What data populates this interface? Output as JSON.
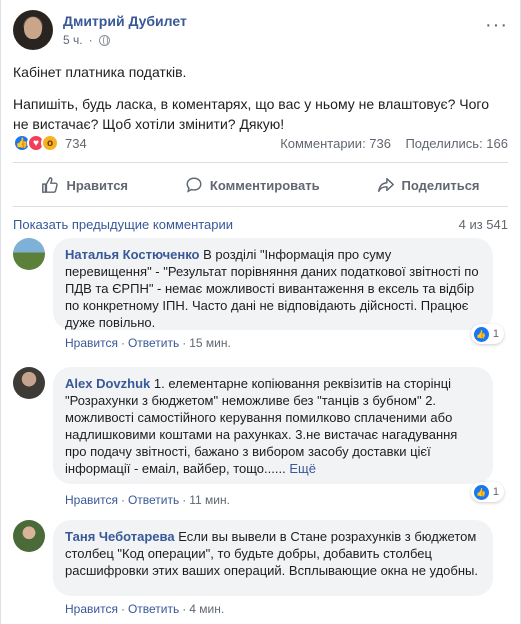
{
  "post": {
    "author": "Дмитрий Дубилет",
    "time": "5 ч.",
    "more": "···",
    "text_1": "Кабінет платника податків.",
    "text_2": "Напишіть, будь ласка, в коментарях, що вас у ньому не влаштовує? Чого не вистачає? Щоб хотіли змінити? Дякую!",
    "reactions_count": "734",
    "comments_count": "Комментарии: 736",
    "shares_count": "Поделились: 166",
    "actions": {
      "like": "Нравится",
      "comment": "Комментировать",
      "share": "Поделиться"
    }
  },
  "comments_header": {
    "show_previous": "Показать предыдущие комментарии",
    "count": "4 из 541"
  },
  "comments": [
    {
      "name": "Наталья Костюченко",
      "text": "В розділі \"Інформація про суму перевищення\" - \"Результат порівняння даних податкової звітності по ПДВ та ЄРПН\" - немає можливості вивантаження в ексель та відбір по конкретному ІПН. Часто дані не відповідають дійсності. Працює дуже повільно.",
      "like": "Нравится",
      "reply": "Ответить",
      "time": "15 мин.",
      "likes": "1"
    },
    {
      "name": "Alex Dovzhuk",
      "text": "1. елементарне копіювання реквізитів на сторінці \"Розрахунки з бюджетом\" неможливе без \"танців з бубном\" 2. можливості самостійного керування помилково сплаченими або надлишковими коштами на рахунках. 3.не вистачає нагадування про подачу звітності, бажано з вибором засобу доставки цієї інформації - емаіл, вайбер, тощо......",
      "more": "Ещё",
      "like": "Нравится",
      "reply": "Ответить",
      "time": "11 мин.",
      "likes": "1"
    },
    {
      "name": "Таня Чеботарева",
      "text": "Если вы вывели в Стане розрахунків з бюджетом столбец \"Код операции\", то будьте добры, добавить столбец расшифровки этих ваших операций. Всплывающие окна не удобны.",
      "like": "Нравится",
      "reply": "Ответить",
      "time": "4 мин."
    }
  ],
  "colors": {
    "link": "#385898",
    "muted": "#606770",
    "bubble": "#f2f3f5",
    "like_blue": "#1877f2",
    "love_red": "#f33e58",
    "wow_yellow": "#f7b125"
  }
}
